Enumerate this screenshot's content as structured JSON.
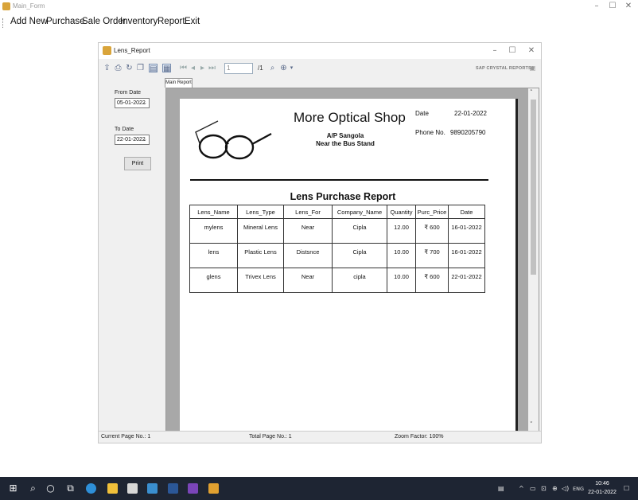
{
  "main_window": {
    "title": "Main_Form",
    "controls": {
      "minimize": "–",
      "maximize": "☐",
      "close": "✕"
    }
  },
  "menu": [
    "Add New",
    "Purchase",
    "Sale Order",
    "Inventory",
    "Report",
    "Exit"
  ],
  "report_window": {
    "title": "Lens_Report",
    "controls": {
      "minimize": "–",
      "maximize": "☐",
      "close": "✕"
    },
    "toolbar": {
      "page_input": "1",
      "page_total": "/1",
      "brand": "SAP CRYSTAL REPORTS®"
    },
    "side_panel": {
      "from_label": "From Date",
      "from_value": "05-01-2022",
      "to_label": "To Date",
      "to_value": "22-01-2022",
      "print_label": "Print"
    },
    "tab_label": "Main Report",
    "report": {
      "shop_name": "More Optical Shop",
      "address_line1": "A/P Sangola",
      "address_line2": "Near the Bus Stand",
      "date_label": "Date",
      "date_value": "22-01-2022",
      "phone_label": "Phone No.",
      "phone_value": "9890205790",
      "title": "Lens Purchase Report",
      "columns": [
        "Lens_Name",
        "Lens_Type",
        "Lens_For",
        "Company_Name",
        "Quantity",
        "Purc_Price",
        "Date"
      ],
      "rows": [
        [
          "mylens",
          "Mineral Lens",
          "Near",
          "Cipla",
          "12.00",
          "₹ 600",
          "16-01-2022"
        ],
        [
          "lens",
          "Plastic Lens",
          "Distsnce",
          "Cipla",
          "10.00",
          "₹ 700",
          "16-01-2022"
        ],
        [
          "glens",
          "Trivex Lens",
          "Near",
          "cipla",
          "10.00",
          "₹ 600",
          "22-01-2022"
        ]
      ]
    },
    "status": {
      "current_page": "Current Page No.: 1",
      "total_page": "Total Page No.: 1",
      "zoom": "Zoom Factor: 100%"
    }
  },
  "taskbar": {
    "lang": "ENG",
    "time": "10:46",
    "date": "22-01-2022"
  }
}
